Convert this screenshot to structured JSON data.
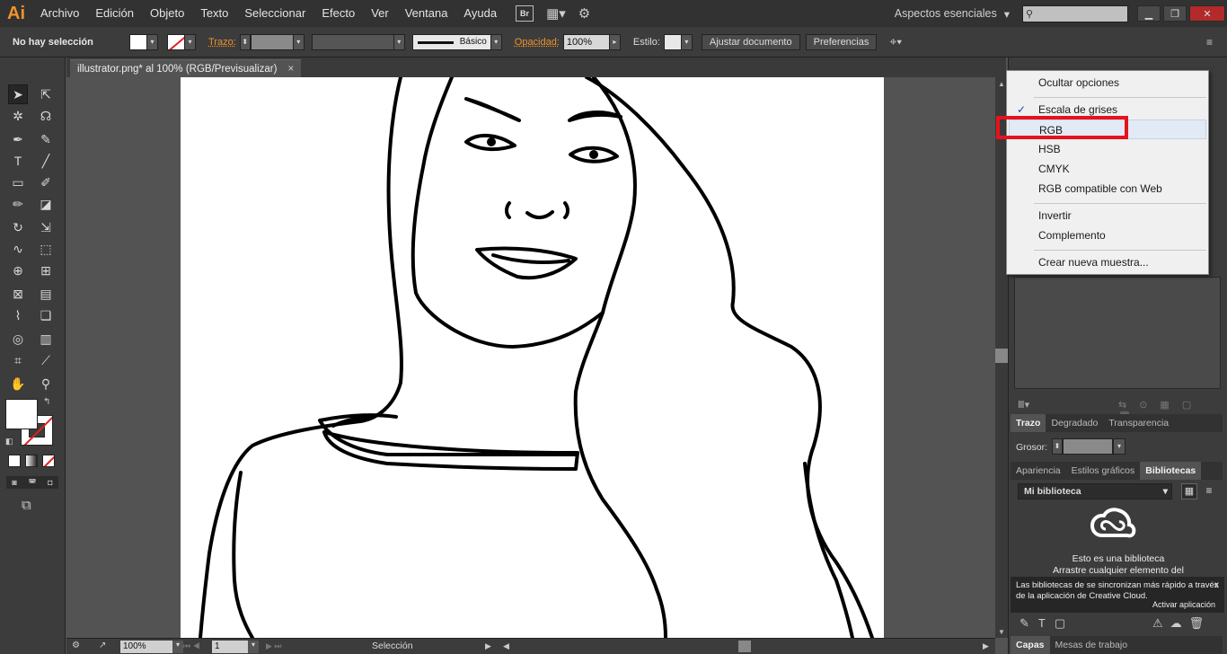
{
  "app": {
    "logo": "Ai"
  },
  "menubar": {
    "items": [
      "Archivo",
      "Edición",
      "Objeto",
      "Texto",
      "Seleccionar",
      "Efecto",
      "Ver",
      "Ventana",
      "Ayuda"
    ],
    "bridge_label": "Br",
    "workspace": "Aspectos esenciales",
    "search_placeholder": ""
  },
  "controlbar": {
    "selection_status": "No hay selección",
    "stroke_label": "Trazo:",
    "profile_label": "Básico",
    "opacity_label": "Opacidad:",
    "opacity_value": "100%",
    "style_label": "Estilo:",
    "doc_setup_button": "Ajustar documento",
    "preferences_button": "Preferencias"
  },
  "document": {
    "tab_title": "illustrator.png* al 100% (RGB/Previsualizar)",
    "close": "×"
  },
  "statusbar": {
    "zoom": "100%",
    "page": "1",
    "status_text": "Selección"
  },
  "popup_menu": {
    "items": [
      {
        "label": "Ocultar opciones",
        "checked": false
      },
      {
        "label": "Escala de grises",
        "checked": true
      },
      {
        "label": "RGB",
        "checked": false
      },
      {
        "label": "HSB",
        "checked": false
      },
      {
        "label": "CMYK",
        "checked": false
      },
      {
        "label": "RGB compatible con Web",
        "checked": false
      },
      {
        "label": "Invertir",
        "checked": false
      },
      {
        "label": "Complemento",
        "checked": false
      },
      {
        "label": "Crear nueva muestra...",
        "checked": false
      }
    ],
    "check_glyph": "✓"
  },
  "panels": {
    "stroke_group_tabs": [
      "Trazo",
      "Degradado",
      "Transparencia"
    ],
    "weight_label": "Grosor:",
    "appearance_group_tabs": [
      "Apariencia",
      "Estilos gráficos",
      "Bibliotecas"
    ],
    "library_name": "Mi biblioteca",
    "library_empty_line1": "Esto es una biblioteca",
    "library_empty_line2": "Arrastre cualquier elemento del",
    "sync_tip": "Las bibliotecas de se sincronizan más rápido a través de la aplicación de Creative Cloud.",
    "sync_close": "x",
    "activate_app": "Activar aplicación",
    "bottom_tabs": [
      "Capas",
      "Mesas de trabajo"
    ]
  },
  "colors": {
    "accent_orange": "#f0932b",
    "highlight_red": "#e6121c",
    "menu_bg": "#f0f0f0"
  }
}
